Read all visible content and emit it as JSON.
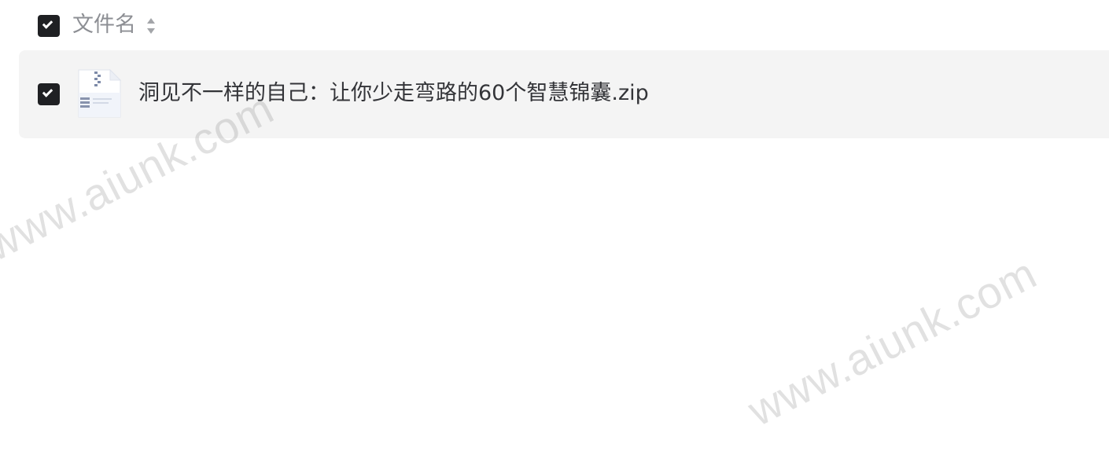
{
  "header": {
    "select_all_checked": true,
    "column_label": "文件名",
    "sort_icon": "sort-icon"
  },
  "files": [
    {
      "name": "洞见不一样的自己：让你少走弯路的60个智慧锦囊.zip",
      "checked": true,
      "icon": "zip-file-icon"
    }
  ],
  "watermark": {
    "text": "www.aiunk.com"
  },
  "colors": {
    "checkbox": "#1f2023",
    "row_background": "#f4f4f4",
    "header_text": "#8d8f94",
    "file_text": "#333438"
  }
}
